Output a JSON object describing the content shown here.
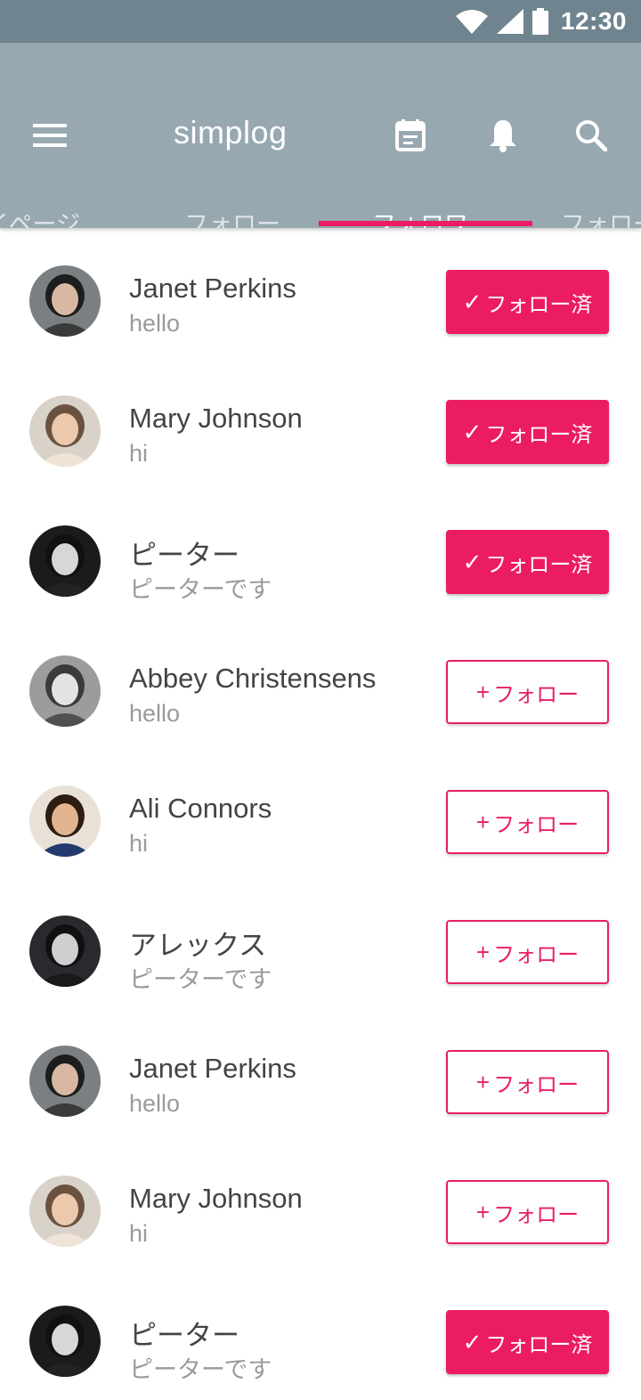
{
  "status_bar": {
    "time": "12:30",
    "icons": [
      "wifi-icon",
      "signal-icon",
      "battery-icon"
    ]
  },
  "app_bar": {
    "title": "simplog",
    "menu_icon": "menu-icon",
    "actions": [
      "calendar-icon",
      "bell-icon",
      "search-icon"
    ]
  },
  "tabs": [
    {
      "label": "マイページ"
    },
    {
      "label": "フォロー"
    },
    {
      "label": "フォロワー",
      "active": true
    },
    {
      "label": "フォロー中"
    }
  ],
  "colors": {
    "accent": "#ec1c64",
    "appbar": "#97a8b0",
    "statusbar": "#6f848e"
  },
  "labels": {
    "followed": "フォロー済",
    "follow": "フォロー"
  },
  "users": [
    {
      "name": "Janet Perkins",
      "message": "hello",
      "followed": true,
      "avatar": "avatar-janet"
    },
    {
      "name": "Mary Johnson",
      "message": "hi",
      "followed": true,
      "avatar": "avatar-mary"
    },
    {
      "name": "ピーター",
      "message": "ピーターです",
      "followed": true,
      "avatar": "avatar-peter"
    },
    {
      "name": "Abbey Christensens",
      "message": "hello",
      "followed": false,
      "avatar": "avatar-abbey"
    },
    {
      "name": "Ali Connors",
      "message": "hi",
      "followed": false,
      "avatar": "avatar-ali"
    },
    {
      "name": "アレックス",
      "message": "ピーターです",
      "followed": false,
      "avatar": "avatar-alex"
    },
    {
      "name": "Janet Perkins",
      "message": "hello",
      "followed": false,
      "avatar": "avatar-janet"
    },
    {
      "name": "Mary Johnson",
      "message": "hi",
      "followed": false,
      "avatar": "avatar-mary"
    },
    {
      "name": "ピーター",
      "message": "ピーターです",
      "followed": true,
      "avatar": "avatar-peter"
    }
  ]
}
